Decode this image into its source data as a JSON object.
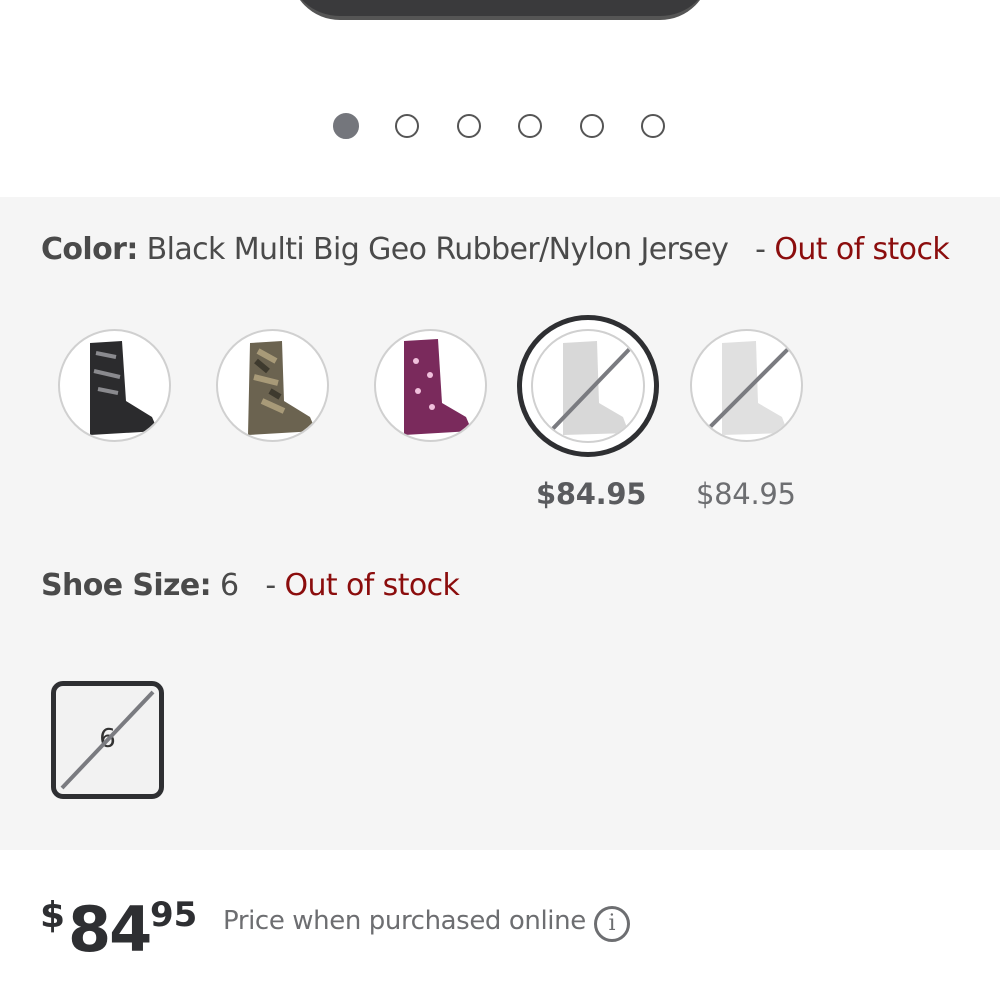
{
  "carousel": {
    "slide_count": 6,
    "active_index": 0
  },
  "color": {
    "label": "Color:",
    "value": "Black Multi Big Geo Rubber/Nylon Jersey",
    "separator": "-",
    "stock_status": "Out of stock",
    "swatches": [
      {
        "name": "Black Multi",
        "tone": "#2b2b2d",
        "available": true,
        "selected": false,
        "price": ""
      },
      {
        "name": "Camo",
        "tone": "#6b6350",
        "available": true,
        "selected": false,
        "price": ""
      },
      {
        "name": "Purple",
        "tone": "#7a2a5c",
        "available": true,
        "selected": false,
        "price": ""
      },
      {
        "name": "Black Multi Big Geo",
        "tone": "#c8c8c8",
        "available": false,
        "selected": true,
        "price": "$84.95"
      },
      {
        "name": "White",
        "tone": "#dcdcdc",
        "available": false,
        "selected": false,
        "price": "$84.95"
      }
    ]
  },
  "size": {
    "label": "Shoe Size:",
    "value": "6",
    "separator": "-",
    "stock_status": "Out of stock",
    "options": [
      {
        "label": "6",
        "available": false,
        "selected": true
      }
    ]
  },
  "price": {
    "currency": "$",
    "dollars": "84",
    "cents": "95",
    "note": "Price when purchased online",
    "info_icon": "info-icon"
  },
  "colors": {
    "out_of_stock": "#8b0d0d",
    "text_dark": "#2e2f32",
    "text_gray": "#6d6e71",
    "panel_bg": "#f5f5f5"
  }
}
